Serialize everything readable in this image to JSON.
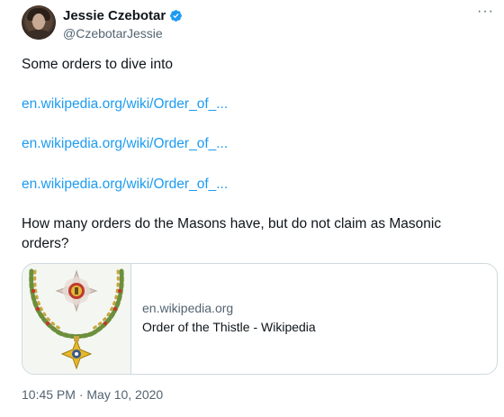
{
  "author": {
    "display_name": "Jessie Czebotar",
    "handle": "@CzebotarJessie",
    "verified": true
  },
  "menu": {
    "more_label": "···"
  },
  "tweet": {
    "intro": "Some orders to dive into",
    "links": [
      "en.wikipedia.org/wiki/Order_of_...",
      "en.wikipedia.org/wiki/Order_of_...",
      "en.wikipedia.org/wiki/Order_of_..."
    ],
    "question_line1": "How many orders do the Masons have, but do not claim as Masonic",
    "question_line2": "orders?",
    "timestamp": "10:45 PM · May 10, 2020"
  },
  "card": {
    "domain": "en.wikipedia.org",
    "title": "Order of the Thistle - Wikipedia",
    "image_icon": "order-of-the-thistle-collar-image"
  },
  "colors": {
    "link": "#1d9bf0",
    "verified_badge": "#1d9bf0",
    "secondary_text": "#536471",
    "border": "#cfd9de"
  }
}
